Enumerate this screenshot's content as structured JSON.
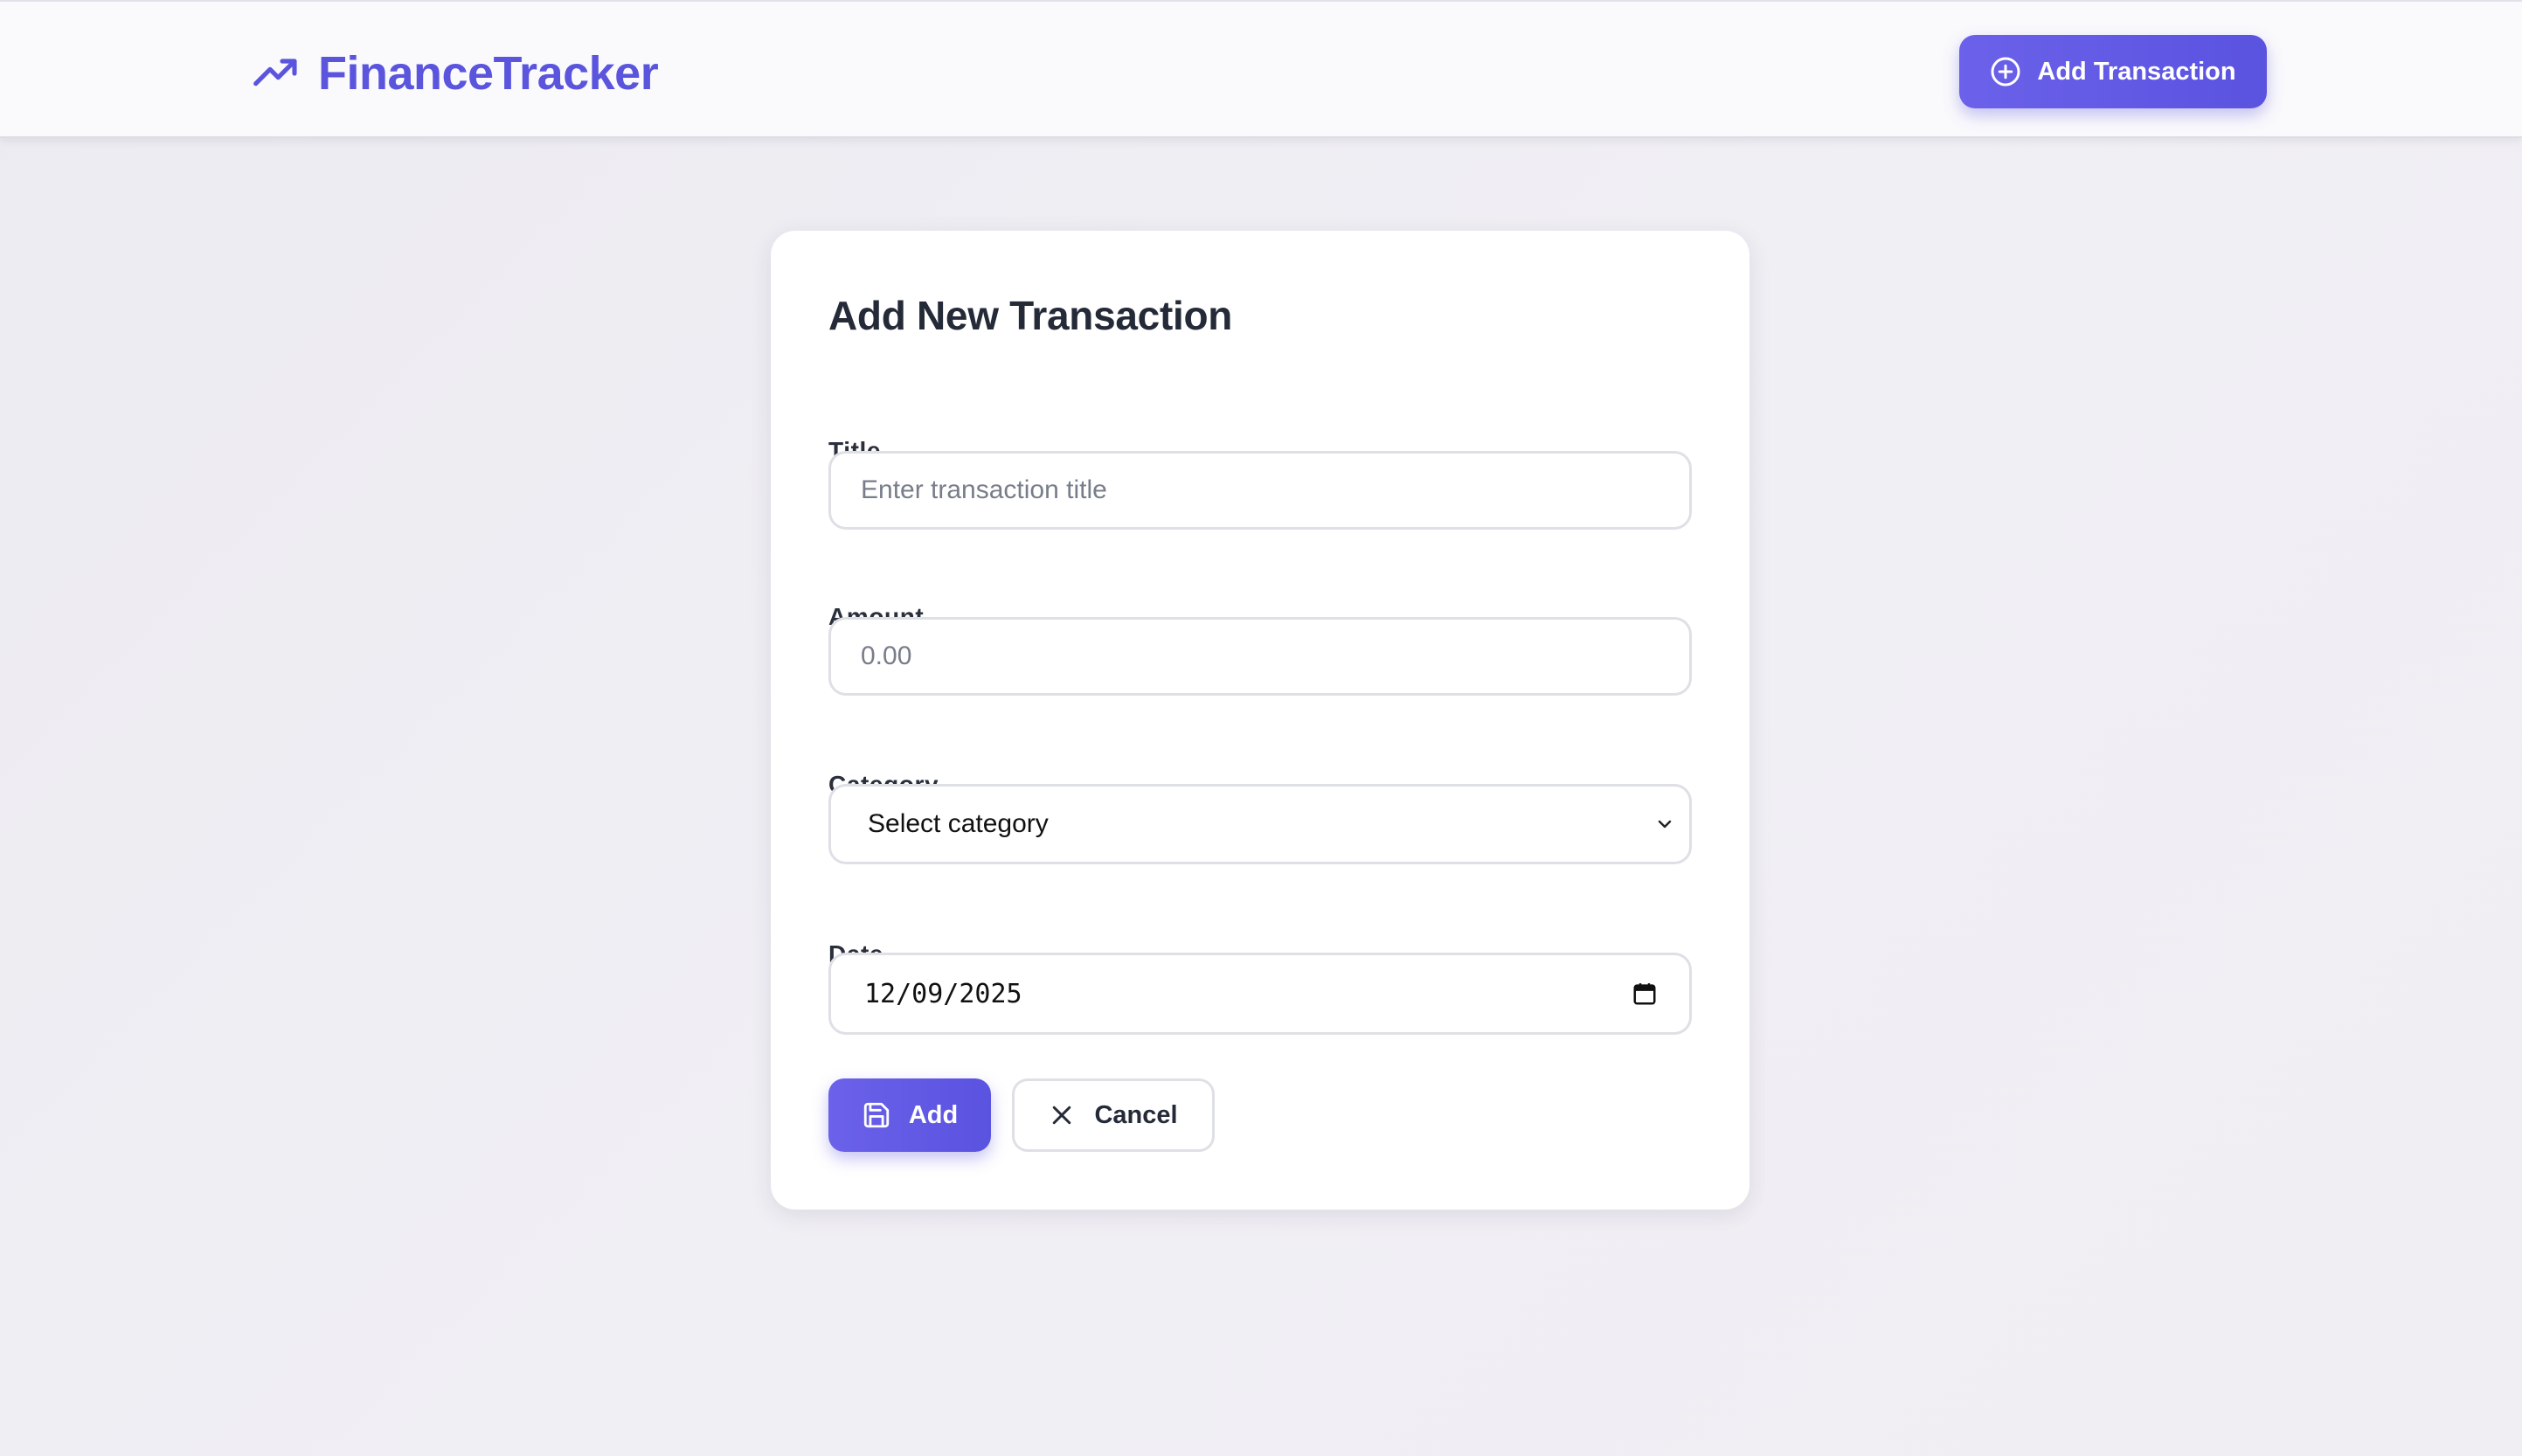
{
  "header": {
    "brand_icon": "trending-up-icon",
    "brand_name": "FinanceTracker",
    "add_button_icon": "plus-circle-icon",
    "add_button_label": "Add Transaction"
  },
  "form": {
    "title": "Add New Transaction",
    "fields": {
      "title": {
        "label": "Title",
        "placeholder": "Enter transaction title",
        "value": ""
      },
      "amount": {
        "label": "Amount",
        "placeholder": "0.00",
        "value": ""
      },
      "category": {
        "label": "Category",
        "selected": "Select category",
        "icon": "chevron-down-icon"
      },
      "date": {
        "label": "Date",
        "value": "12/09/2025",
        "icon": "calendar-icon"
      }
    },
    "actions": {
      "add_label": "Add",
      "add_icon": "save-icon",
      "cancel_label": "Cancel",
      "cancel_icon": "close-icon"
    }
  },
  "colors": {
    "accent": "#5b55de",
    "accent_light": "#6b61ea",
    "text_dark": "#252a38",
    "border": "#dfe0e6",
    "background": "#eeedf2"
  }
}
